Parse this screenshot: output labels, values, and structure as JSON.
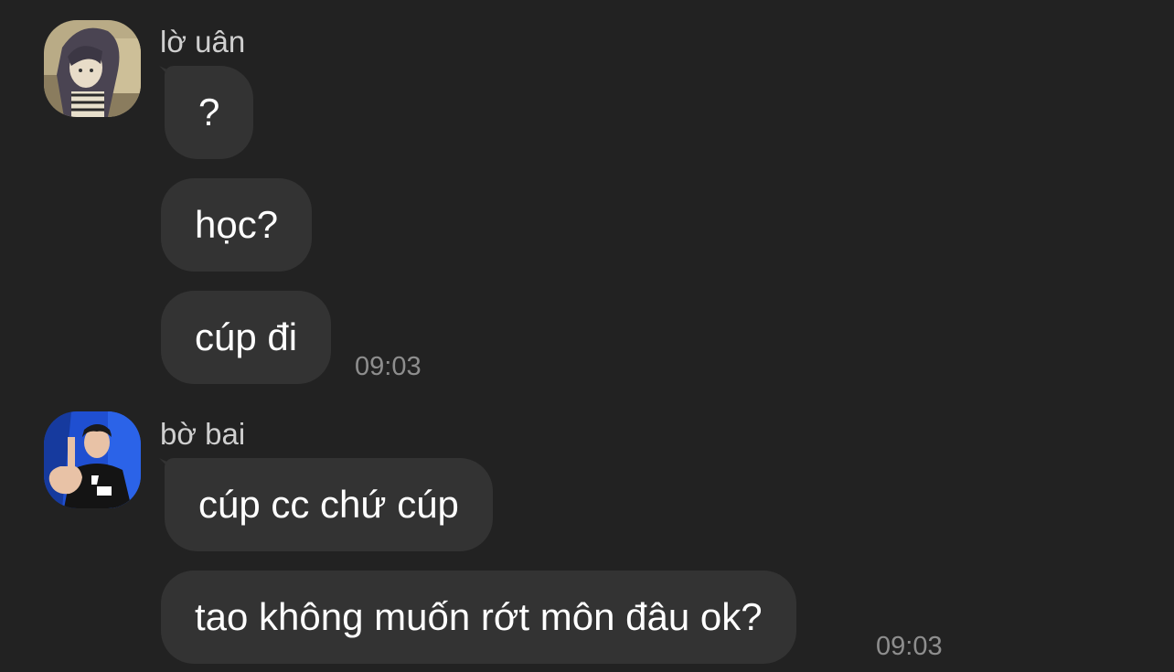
{
  "conversation": {
    "groups": [
      {
        "sender": "lờ uân",
        "avatar_icon": "anime-girl-avatar-icon",
        "messages": [
          "?",
          "học?",
          "cúp đi"
        ],
        "time": "09:03"
      },
      {
        "sender": "bờ bai",
        "avatar_icon": "esports-player-avatar-icon",
        "messages": [
          "cúp cc chứ cúp",
          "tao không muốn rớt môn đâu ok?"
        ],
        "time": "09:03"
      }
    ]
  },
  "colors": {
    "background": "#222222",
    "bubble": "#333333",
    "text": "#ffffff",
    "sender": "#cfcfcf",
    "timestamp": "#8e8e8e"
  }
}
